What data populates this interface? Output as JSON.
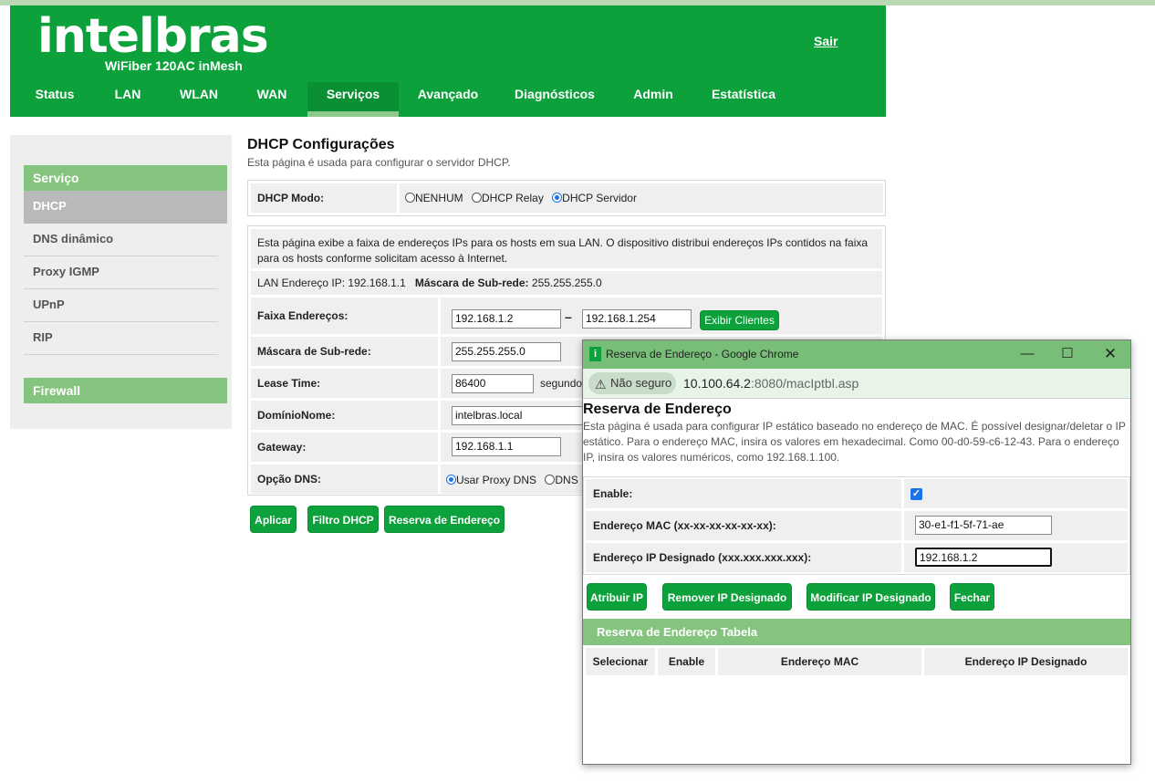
{
  "header": {
    "logo": "intelbras",
    "model": "WiFiber 120AC inMesh",
    "logout": "Sair",
    "nav": [
      {
        "label": "Status"
      },
      {
        "label": "LAN"
      },
      {
        "label": "WLAN"
      },
      {
        "label": "WAN"
      },
      {
        "label": "Serviços"
      },
      {
        "label": "Avançado"
      },
      {
        "label": "Diagnósticos"
      },
      {
        "label": "Admin"
      },
      {
        "label": "Estatística"
      }
    ],
    "active_nav": "Serviços"
  },
  "sidebar": {
    "section1": "Serviço",
    "items": [
      {
        "label": "DHCP"
      },
      {
        "label": "DNS dinâmico"
      },
      {
        "label": "Proxy IGMP"
      },
      {
        "label": "UPnP"
      },
      {
        "label": "RIP"
      }
    ],
    "active_item": "DHCP",
    "section2": "Firewall"
  },
  "main": {
    "title": "DHCP Configurações",
    "subtitle": "Esta página é usada para configurar o servidor DHCP.",
    "mode_label": "DHCP Modo:",
    "mode_options": [
      "NENHUM",
      "DHCP Relay",
      "DHCP Servidor"
    ],
    "mode_selected": "DHCP Servidor",
    "info": "Esta página exibe a faixa de endereços IPs para os hosts em sua LAN. O dispositivo distribui endereços IPs contidos na faixa para os hosts conforme solicitam acesso à Internet.",
    "lan_ip_label": "LAN Endereço IP:",
    "lan_ip": "192.168.1.1",
    "mask_label": "Máscara de Sub-rede:",
    "mask": "255.255.255.0",
    "range_label": "Faixa Endereços:",
    "range_start": "192.168.1.2",
    "range_sep": "–",
    "range_end": "192.168.1.254",
    "show_clients": "Exibir Clientes",
    "subnet_label": "Máscara de Sub-rede:",
    "subnet_value": "255.255.255.0",
    "lease_label": "Lease Time:",
    "lease_value": "86400",
    "lease_unit": "segundo",
    "domain_label": "DomínioNome:",
    "domain_value": "intelbras.local",
    "gateway_label": "Gateway:",
    "gateway_value": "192.168.1.1",
    "dns_label": "Opção DNS:",
    "dns_options": [
      "Usar Proxy DNS",
      "DNS"
    ],
    "dns_selected": "Usar Proxy DNS",
    "btn_apply": "Aplicar",
    "btn_filter": "Filtro DHCP",
    "btn_reserve": "Reserva de Endereço"
  },
  "popup": {
    "window_title": "Reserva de Endereço - Google Chrome",
    "security": "Não seguro",
    "url_host": "10.100.64.2",
    "url_rest": ":8080/macIptbl.asp",
    "title": "Reserva de Endereço",
    "desc": "Esta página é usada para configurar IP estático baseado no endereço de MAC. É possível designar/deletar o IP estático. Para o endereço MAC, insira os valores em hexadecimal. Como 00-d0-59-c6-12-43. Para o endereço IP, insira os valores numéricos, como 192.168.1.100.",
    "enable_label": "Enable:",
    "enable_checked": true,
    "mac_label": "Endereço MAC (xx-xx-xx-xx-xx-xx):",
    "mac_value": "30-e1-f1-5f-71-ae",
    "ip_label": "Endereço IP Designado (xxx.xxx.xxx.xxx):",
    "ip_value": "192.168.1.2",
    "btn_assign": "Atribuir IP",
    "btn_remove": "Remover IP Designado",
    "btn_modify": "Modificar IP Designado",
    "btn_close": "Fechar",
    "table_title": "Reserva de Endereço Tabela",
    "columns": [
      "Selecionar",
      "Enable",
      "Endereço MAC",
      "Endereço IP Designado"
    ]
  },
  "colors": {
    "brand_green": "#0da13b",
    "light_green": "#84c47e",
    "title_bar": "#78bd78"
  }
}
